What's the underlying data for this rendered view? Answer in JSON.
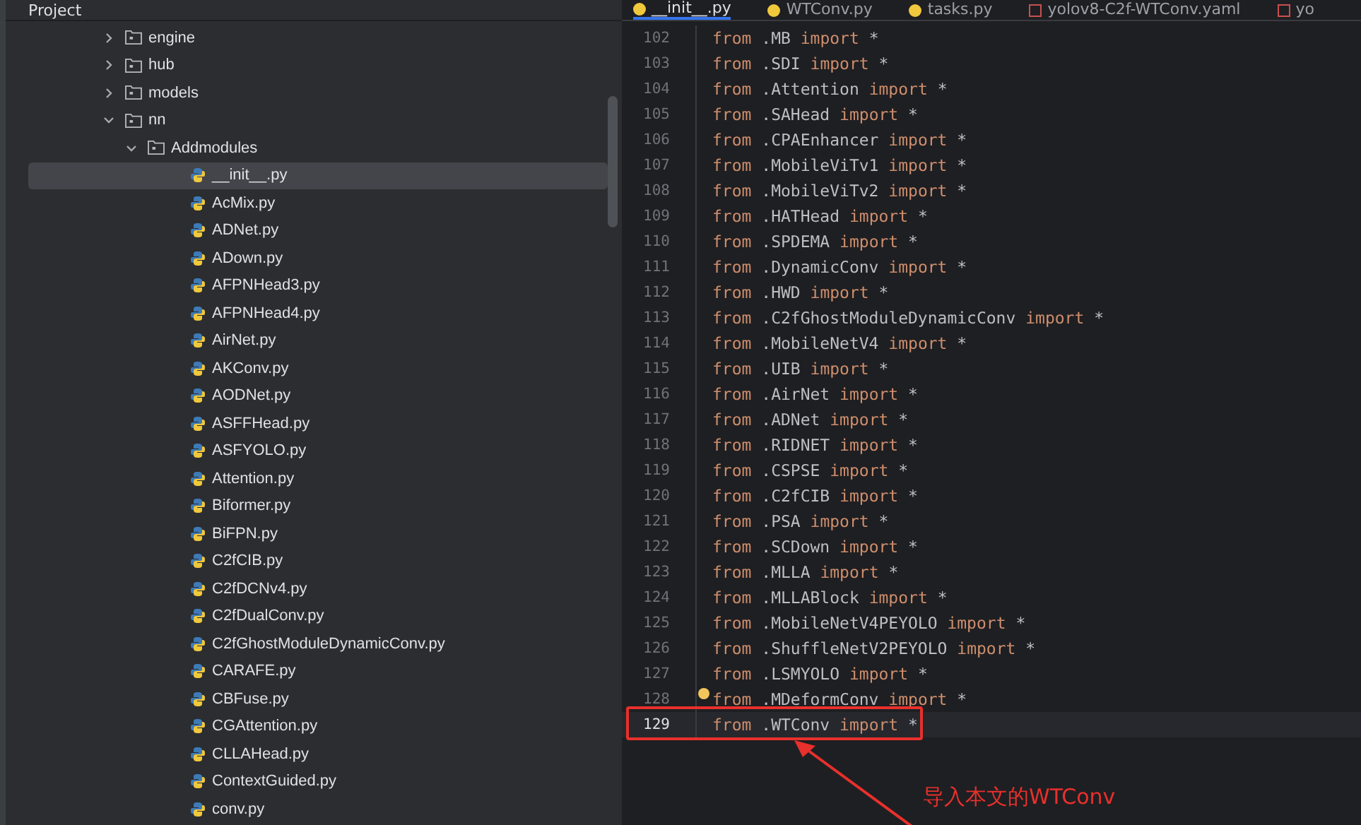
{
  "project_panel": {
    "title": "Project",
    "tree": [
      {
        "kind": "folder",
        "label": "engine",
        "expanded": false,
        "selected": false
      },
      {
        "kind": "folder",
        "label": "hub",
        "expanded": false,
        "selected": false
      },
      {
        "kind": "folder",
        "label": "models",
        "expanded": false,
        "selected": false
      },
      {
        "kind": "folder",
        "label": "nn",
        "expanded": true,
        "selected": false,
        "children": [
          {
            "kind": "folder",
            "label": "Addmodules",
            "expanded": true,
            "selected": false,
            "children": [
              {
                "kind": "file",
                "label": "__init__.py",
                "selected": true
              },
              {
                "kind": "file",
                "label": "AcMix.py",
                "selected": false
              },
              {
                "kind": "file",
                "label": "ADNet.py",
                "selected": false
              },
              {
                "kind": "file",
                "label": "ADown.py",
                "selected": false
              },
              {
                "kind": "file",
                "label": "AFPNHead3.py",
                "selected": false
              },
              {
                "kind": "file",
                "label": "AFPNHead4.py",
                "selected": false
              },
              {
                "kind": "file",
                "label": "AirNet.py",
                "selected": false
              },
              {
                "kind": "file",
                "label": "AKConv.py",
                "selected": false
              },
              {
                "kind": "file",
                "label": "AODNet.py",
                "selected": false
              },
              {
                "kind": "file",
                "label": "ASFFHead.py",
                "selected": false
              },
              {
                "kind": "file",
                "label": "ASFYOLO.py",
                "selected": false
              },
              {
                "kind": "file",
                "label": "Attention.py",
                "selected": false
              },
              {
                "kind": "file",
                "label": "Biformer.py",
                "selected": false
              },
              {
                "kind": "file",
                "label": "BiFPN.py",
                "selected": false
              },
              {
                "kind": "file",
                "label": "C2fCIB.py",
                "selected": false
              },
              {
                "kind": "file",
                "label": "C2fDCNv4.py",
                "selected": false
              },
              {
                "kind": "file",
                "label": "C2fDualConv.py",
                "selected": false
              },
              {
                "kind": "file",
                "label": "C2fGhostModuleDynamicConv.py",
                "selected": false
              },
              {
                "kind": "file",
                "label": "CARAFE.py",
                "selected": false
              },
              {
                "kind": "file",
                "label": "CBFuse.py",
                "selected": false
              },
              {
                "kind": "file",
                "label": "CGAttention.py",
                "selected": false
              },
              {
                "kind": "file",
                "label": "CLLAHead.py",
                "selected": false
              },
              {
                "kind": "file",
                "label": "ContextGuided.py",
                "selected": false
              },
              {
                "kind": "file",
                "label": "conv.py",
                "selected": false
              }
            ]
          }
        ]
      }
    ]
  },
  "editor": {
    "tabs": [
      {
        "kind": "python",
        "label": "__init__.py",
        "selected": true
      },
      {
        "kind": "python",
        "label": "WTConv.py",
        "selected": false
      },
      {
        "kind": "python",
        "label": "tasks.py",
        "selected": false
      },
      {
        "kind": "yaml",
        "label": "yolov8-C2f-WTConv.yaml",
        "selected": false
      },
      {
        "kind": "yaml",
        "label": "yo",
        "selected": false
      }
    ],
    "lines": [
      {
        "number": "102",
        "code": "from .MB import *",
        "selected": false
      },
      {
        "number": "103",
        "code": "from .SDI import *",
        "selected": false
      },
      {
        "number": "104",
        "code": "from .Attention import *",
        "selected": false
      },
      {
        "number": "105",
        "code": "from .SAHead import *",
        "selected": false
      },
      {
        "number": "106",
        "code": "from .CPAEnhancer import *",
        "selected": false
      },
      {
        "number": "107",
        "code": "from .MobileViTv1 import *",
        "selected": false
      },
      {
        "number": "108",
        "code": "from .MobileViTv2 import *",
        "selected": false
      },
      {
        "number": "109",
        "code": "from .HATHead import *",
        "selected": false
      },
      {
        "number": "110",
        "code": "from .SPDEMA import *",
        "selected": false
      },
      {
        "number": "111",
        "code": "from .DynamicConv import *",
        "selected": false
      },
      {
        "number": "112",
        "code": "from .HWD import *",
        "selected": false
      },
      {
        "number": "113",
        "code": "from .C2fGhostModuleDynamicConv import *",
        "selected": false
      },
      {
        "number": "114",
        "code": "from .MobileNetV4 import *",
        "selected": false
      },
      {
        "number": "115",
        "code": "from .UIB import *",
        "selected": false
      },
      {
        "number": "116",
        "code": "from .AirNet import *",
        "selected": false
      },
      {
        "number": "117",
        "code": "from .ADNet import *",
        "selected": false
      },
      {
        "number": "118",
        "code": "from .RIDNET import *",
        "selected": false
      },
      {
        "number": "119",
        "code": "from .CSPSE import *",
        "selected": false
      },
      {
        "number": "120",
        "code": "from .C2fCIB import *",
        "selected": false
      },
      {
        "number": "121",
        "code": "from .PSA import *",
        "selected": false
      },
      {
        "number": "122",
        "code": "from .SCDown import *",
        "selected": false
      },
      {
        "number": "123",
        "code": "from .MLLA import *",
        "selected": false
      },
      {
        "number": "124",
        "code": "from .MLLABlock import *",
        "selected": false
      },
      {
        "number": "125",
        "code": "from .MobileNetV4PEYOLO import *",
        "selected": false
      },
      {
        "number": "126",
        "code": "from .ShuffleNetV2PEYOLO import *",
        "selected": false
      },
      {
        "number": "127",
        "code": "from .LSMYOLO import *",
        "selected": false
      },
      {
        "number": "128",
        "code": "from .MDeformConv import *",
        "selected": false,
        "bulb": true
      },
      {
        "number": "129",
        "code": "from .WTConv import *",
        "selected": true
      }
    ],
    "annotation": "导入本文的WTConv"
  }
}
